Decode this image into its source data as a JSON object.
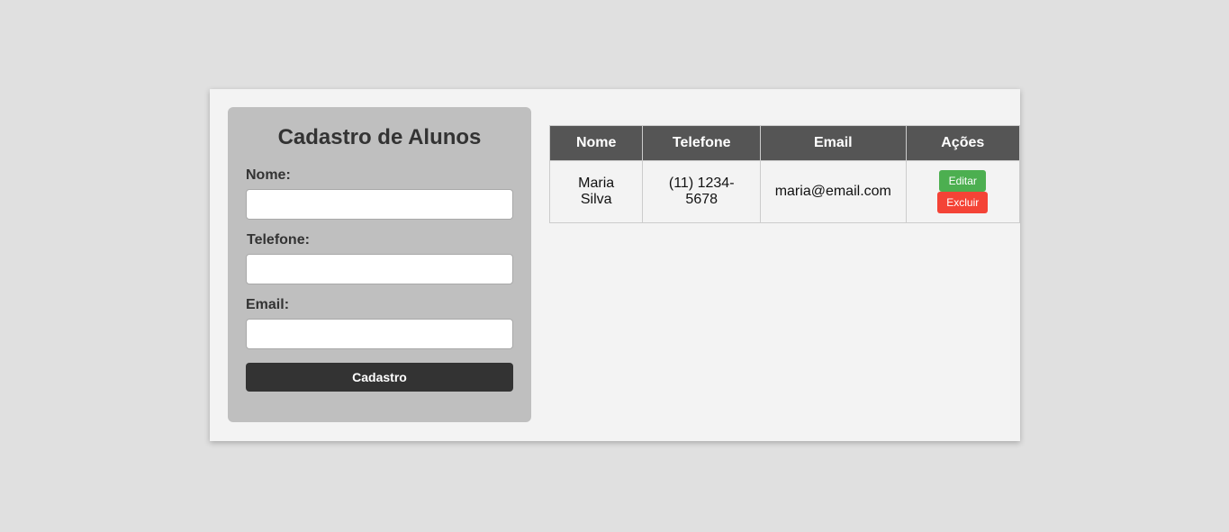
{
  "form": {
    "title": "Cadastro de Alunos",
    "fields": [
      {
        "label": "Nome:",
        "value": "",
        "placeholder": ""
      },
      {
        "label": "Telefone:",
        "value": "",
        "placeholder": ""
      },
      {
        "label": "Email:",
        "value": "",
        "placeholder": ""
      }
    ],
    "submit_label": "Cadastro"
  },
  "table": {
    "headers": [
      "Nome",
      "Telefone",
      "Email",
      "Ações"
    ],
    "rows": [
      {
        "nome": "Maria Silva",
        "telefone": "(11) 1234-5678",
        "email": "maria@email.com",
        "edit_label": "Editar",
        "delete_label": "Excluir"
      }
    ]
  },
  "colors": {
    "page_background": "#e0e0e0",
    "container_background": "#f3f3f3",
    "form_panel": "#bfbfbf",
    "primary_button": "#333333",
    "table_header": "#555555",
    "edit_button": "#4caf50",
    "delete_button": "#f44336"
  }
}
